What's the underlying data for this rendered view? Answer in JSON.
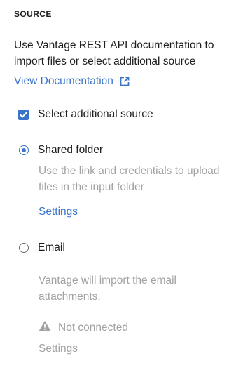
{
  "source": {
    "title": "SOURCE",
    "description": "Use Vantage REST API documentation to import files or select additional source",
    "doc_link_label": "View Documentation",
    "additional_source": {
      "label": "Select additional source",
      "checked": true
    },
    "options": [
      {
        "label": "Shared folder",
        "selected": true,
        "hint": "Use the link and credentials to upload files in the input folder",
        "settings_label": "Settings"
      },
      {
        "label": "Email",
        "selected": false,
        "hint": "Vantage will import the email attachments.",
        "status": "Not connected",
        "status_icon": "warning-icon",
        "settings_label": "Settings"
      }
    ]
  },
  "colors": {
    "accent": "#3a74c9",
    "text": "#1e1e1e",
    "muted": "#a2a2a2"
  }
}
